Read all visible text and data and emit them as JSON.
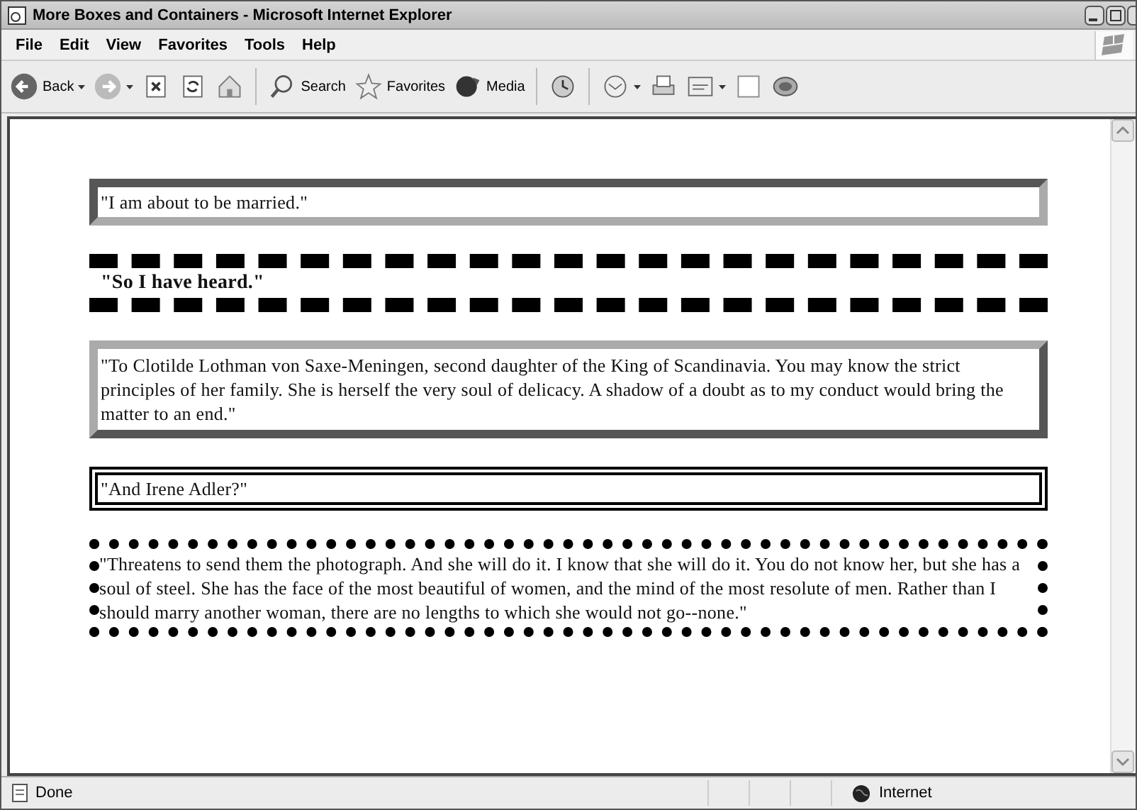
{
  "window": {
    "title": "More Boxes and Containers - Microsoft Internet Explorer"
  },
  "menu": [
    "File",
    "Edit",
    "View",
    "Favorites",
    "Tools",
    "Help"
  ],
  "toolbar": [
    {
      "kind": "back",
      "label": "Back",
      "dropdown": true
    },
    {
      "kind": "forward",
      "dropdown": true
    },
    {
      "kind": "stop",
      "dropdown": false
    },
    {
      "kind": "refresh",
      "dropdown": false
    },
    {
      "kind": "home",
      "dropdown": false
    },
    {
      "kind": "search",
      "label": "Search",
      "dropdown": false
    },
    {
      "kind": "favorites",
      "label": "Favorites",
      "dropdown": false
    },
    {
      "kind": "media",
      "label": "Media",
      "dropdown": false
    },
    {
      "kind": "history",
      "dropdown": false
    },
    {
      "kind": "mail",
      "dropdown": true
    },
    {
      "kind": "print",
      "dropdown": false
    },
    {
      "kind": "edit",
      "dropdown": true
    },
    {
      "kind": "discuss",
      "dropdown": false
    },
    {
      "kind": "messenger",
      "dropdown": false
    }
  ],
  "boxes": [
    {
      "kind": "inset",
      "bold": false,
      "text": "\"I am about to be married.\""
    },
    {
      "kind": "dashed",
      "bold": true,
      "text": "\"So I have heard.\""
    },
    {
      "kind": "outset",
      "bold": false,
      "text": "\"To Clotilde Lothman von Saxe-Meningen, second daughter of the King of Scandinavia. You may know the strict principles of her family. She is herself the very soul of delicacy. A shadow of a doubt as to my conduct would bring the matter to an end.\""
    },
    {
      "kind": "double",
      "bold": false,
      "text": "\"And Irene Adler?\""
    },
    {
      "kind": "dotted",
      "bold": false,
      "text": "\"Threatens to send them the photograph. And she will do it. I know that she will do it. You do not know her, but she has a soul of steel. She has the face of the most beautiful of women, and the mind of the most resolute of men. Rather than I should marry another woman, there are no lengths to which she would not go--none.\""
    }
  ],
  "status_bar": {
    "text": "Done",
    "zone": "Internet"
  }
}
